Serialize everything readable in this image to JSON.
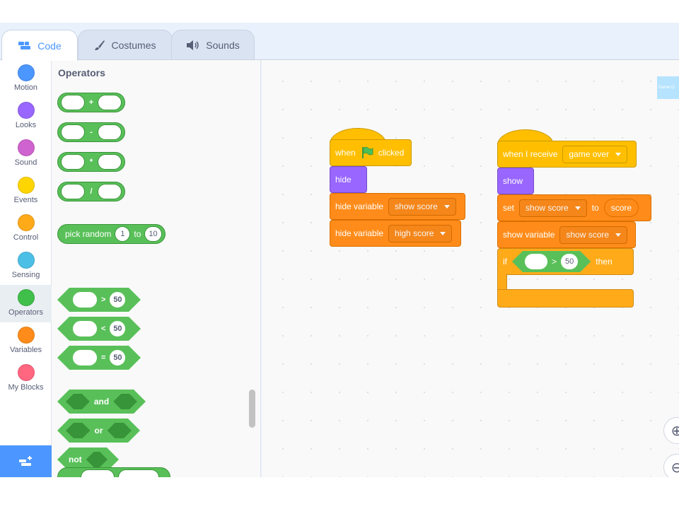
{
  "tabs": [
    {
      "label": "Code",
      "icon": "code-icon",
      "active": true
    },
    {
      "label": "Costumes",
      "icon": "brush-icon",
      "active": false
    },
    {
      "label": "Sounds",
      "icon": "speaker-icon",
      "active": false
    }
  ],
  "categories": [
    {
      "label": "Motion",
      "color": "#4c97ff"
    },
    {
      "label": "Looks",
      "color": "#9966ff"
    },
    {
      "label": "Sound",
      "color": "#cf63cf"
    },
    {
      "label": "Events",
      "color": "#ffd500"
    },
    {
      "label": "Control",
      "color": "#ffab19"
    },
    {
      "label": "Sensing",
      "color": "#4cbfe6"
    },
    {
      "label": "Operators",
      "color": "#40bf4a",
      "selected": true
    },
    {
      "label": "Variables",
      "color": "#ff8c1a"
    },
    {
      "label": "My Blocks",
      "color": "#ff6680"
    }
  ],
  "flyout": {
    "title": "Operators",
    "arith_ops": [
      "+",
      "-",
      "*",
      "/"
    ],
    "random": {
      "label": "pick random",
      "from": "1",
      "to_label": "to",
      "to": "10"
    },
    "compare": [
      {
        "op": ">",
        "value": "50"
      },
      {
        "op": "<",
        "value": "50"
      },
      {
        "op": "=",
        "value": "50"
      }
    ],
    "logic": {
      "and": "and",
      "or": "or",
      "not": "not"
    }
  },
  "script1": {
    "hat_when": "when",
    "hat_clicked": "clicked",
    "hide": "hide",
    "hide_var_label": "hide variable",
    "var1": "show score",
    "var2": "high score"
  },
  "script2": {
    "hat_label": "when I receive",
    "message": "game over",
    "show": "show",
    "set_label": "set",
    "set_var": "show score",
    "to_label": "to",
    "set_value": "score",
    "show_var_label": "show variable",
    "show_var": "show score",
    "if_label": "if",
    "cmp_op": ">",
    "cmp_value": "50",
    "then_label": "then"
  },
  "stage_peek_text": "Game O"
}
